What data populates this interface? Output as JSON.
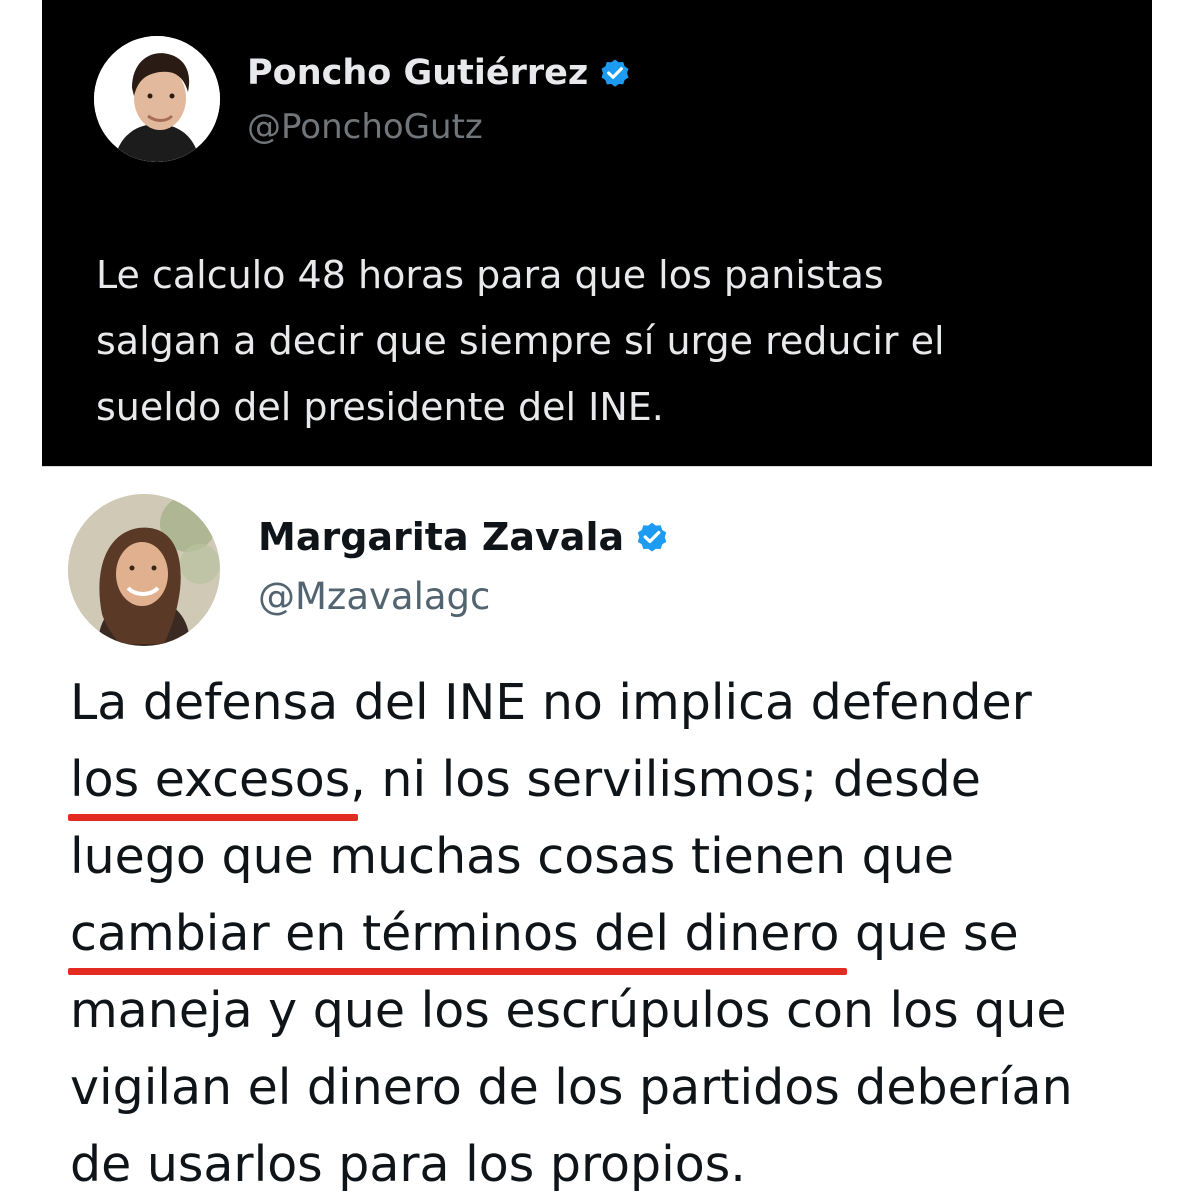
{
  "tweets": [
    {
      "display_name": "Poncho Gutiérrez",
      "handle": "@PonchoGutz",
      "verified_icon": "verified-badge-icon",
      "text_lines": [
        "Le calculo 48 horas para que los panistas",
        "salgan a decir que siempre sí urge reducir el",
        "sueldo del presidente del INE."
      ]
    },
    {
      "display_name": "Margarita Zavala",
      "handle": "@Mzavalagc",
      "verified_icon": "verified-badge-icon",
      "text": {
        "line1": "La defensa del INE no implica defender",
        "line2_highlight": "los excesos",
        "line2_rest": ", ni los servilismos; desde",
        "line3": "luego que muchas cosas tienen que",
        "line4_highlight": "cambiar en términos del dinero",
        "line4_rest": " que se",
        "line5": "maneja y que los escrúpulos con los que",
        "line6": "vigilan el dinero de los partidos deberían",
        "line7": "de usarlos para los propios."
      }
    }
  ],
  "colors": {
    "dark_bg": "#000000",
    "verified_blue": "#1d9bf0",
    "highlight_underline": "#e32b22"
  }
}
